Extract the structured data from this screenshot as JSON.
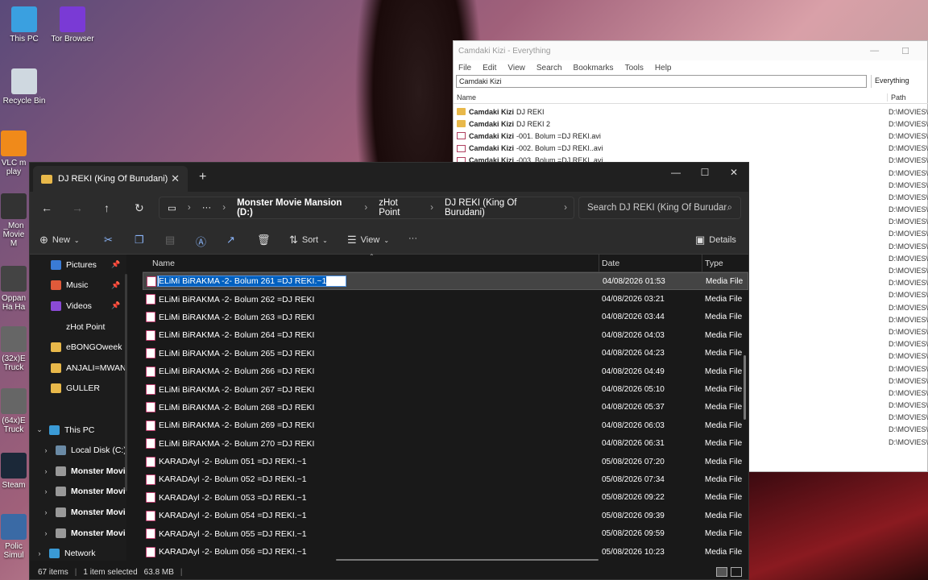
{
  "desktop": {
    "icons": [
      {
        "label": "This PC"
      },
      {
        "label": "Tor Browser"
      },
      {
        "label": "Recycle Bin"
      },
      {
        "label": "VLC m\nplay"
      },
      {
        "label": "_Mon\nMovie M"
      },
      {
        "label": "Oppan\nHa Ha"
      },
      {
        "label": "(32x)E\nTruck"
      },
      {
        "label": "(64x)E\nTruck"
      },
      {
        "label": "Steam"
      },
      {
        "label": "Polic\nSimul"
      }
    ]
  },
  "everything": {
    "title": "Camdaki Kizi - Everything",
    "menu": [
      "File",
      "Edit",
      "View",
      "Search",
      "Bookmarks",
      "Tools",
      "Help"
    ],
    "search_value": "Camdaki Kizi",
    "filter": "Everything",
    "col_name": "Name",
    "col_path": "Path",
    "rows": [
      {
        "type": "folder",
        "bold": "Camdaki Kizi",
        "rest": "DJ REKI"
      },
      {
        "type": "folder",
        "bold": "Camdaki Kizi",
        "rest": "DJ REKI 2"
      },
      {
        "type": "media",
        "bold": "Camdaki Kizi",
        "rest": "-001. Bolum =DJ REKI.avi"
      },
      {
        "type": "media",
        "bold": "Camdaki Kizi",
        "rest": "-002. Bolum =DJ REKI..avi"
      },
      {
        "type": "media",
        "bold": "Camdaki Kizi",
        "rest": "-003. Bolum =DJ REKI..avi"
      }
    ],
    "path_prefix": "D:\\MOVIES\\",
    "path_count": 28
  },
  "explorer": {
    "tab_title": "DJ REKI (King Of Burudani)",
    "breadcrumb": [
      "Monster Movie Mansion (D:)",
      "zHot Point",
      "DJ REKI (King Of Burudani)"
    ],
    "search_placeholder": "Search DJ REKI (King Of Burudar",
    "toolbar": {
      "new": "New",
      "sort": "Sort",
      "view": "View",
      "details": "Details"
    },
    "sidebar": [
      {
        "label": "Pictures",
        "color": "#3a7bd5",
        "pin": true,
        "indent": 26
      },
      {
        "label": "Music",
        "color": "#e05a3a",
        "pin": true,
        "indent": 26
      },
      {
        "label": "Videos",
        "color": "#8a4ad5",
        "pin": true,
        "indent": 26
      },
      {
        "label": "zHot Point",
        "color": "",
        "pin": false,
        "indent": 26
      },
      {
        "label": "eBONGOweek",
        "color": "#e8b84a",
        "pin": false,
        "indent": 26
      },
      {
        "label": "ANJALI=MWAN",
        "color": "#e8b84a",
        "pin": false,
        "indent": 26
      },
      {
        "label": "GULLER",
        "color": "#e8b84a",
        "pin": false,
        "indent": 26
      },
      {
        "label": "",
        "color": "",
        "pin": false,
        "indent": 0
      },
      {
        "label": "This PC",
        "color": "#3a9ad5",
        "pin": false,
        "indent": 6,
        "chev": "⌄"
      },
      {
        "label": "Local Disk (C:)",
        "color": "#6a8aa5",
        "pin": false,
        "indent": 14,
        "chev": "›"
      },
      {
        "label": "Monster Movi",
        "color": "#999",
        "pin": false,
        "indent": 14,
        "chev": "›",
        "bold": true
      },
      {
        "label": "Monster Movi",
        "color": "#999",
        "pin": false,
        "indent": 14,
        "chev": "›",
        "bold": true
      },
      {
        "label": "Monster Movi",
        "color": "#999",
        "pin": false,
        "indent": 14,
        "chev": "›",
        "bold": true
      },
      {
        "label": "Monster Movi",
        "color": "#999",
        "pin": false,
        "indent": 14,
        "chev": "›",
        "bold": true
      },
      {
        "label": "Network",
        "color": "#3a9ad5",
        "pin": false,
        "indent": 6,
        "chev": "›"
      }
    ],
    "columns": {
      "name": "Name",
      "date": "Date",
      "type": "Type"
    },
    "files": [
      {
        "name": "ELiMi BiRAKMA -2- Bolum 261 =DJ REKI.~1",
        "date": "04/08/2026 01:53",
        "type": "Media File",
        "selected": true
      },
      {
        "name": "ELiMi BiRAKMA -2- Bolum 262 =DJ REKI",
        "date": "04/08/2026 03:21",
        "type": "Media File"
      },
      {
        "name": "ELiMi BiRAKMA -2- Bolum 263 =DJ REKI",
        "date": "04/08/2026 03:44",
        "type": "Media File"
      },
      {
        "name": "ELiMi BiRAKMA -2- Bolum 264 =DJ REKI",
        "date": "04/08/2026 04:03",
        "type": "Media File"
      },
      {
        "name": "ELiMi BiRAKMA -2- Bolum 265 =DJ REKI",
        "date": "04/08/2026 04:23",
        "type": "Media File"
      },
      {
        "name": "ELiMi BiRAKMA -2- Bolum 266 =DJ REKI",
        "date": "04/08/2026 04:49",
        "type": "Media File"
      },
      {
        "name": "ELiMi BiRAKMA -2- Bolum 267 =DJ REKI",
        "date": "04/08/2026 05:10",
        "type": "Media File"
      },
      {
        "name": "ELiMi BiRAKMA -2- Bolum 268 =DJ REKI",
        "date": "04/08/2026 05:37",
        "type": "Media File"
      },
      {
        "name": "ELiMi BiRAKMA -2- Bolum 269 =DJ REKI",
        "date": "04/08/2026 06:03",
        "type": "Media File"
      },
      {
        "name": "ELiMi BiRAKMA -2- Bolum 270 =DJ REKI",
        "date": "04/08/2026 06:31",
        "type": "Media File"
      },
      {
        "name": "KARADAyl -2- Bolum 051 =DJ REKI.~1",
        "date": "05/08/2026 07:20",
        "type": "Media File"
      },
      {
        "name": "KARADAyl -2- Bolum 052 =DJ REKI.~1",
        "date": "05/08/2026 07:34",
        "type": "Media File"
      },
      {
        "name": "KARADAyl -2- Bolum 053 =DJ REKI.~1",
        "date": "05/08/2026 09:22",
        "type": "Media File"
      },
      {
        "name": "KARADAyl -2- Bolum 054 =DJ REKI.~1",
        "date": "05/08/2026 09:39",
        "type": "Media File"
      },
      {
        "name": "KARADAyl -2- Bolum 055 =DJ REKI.~1",
        "date": "05/08/2026 09:59",
        "type": "Media File"
      },
      {
        "name": "KARADAyl -2- Bolum 056 =DJ REKI.~1",
        "date": "05/08/2026 10:23",
        "type": "Media File"
      }
    ],
    "status": {
      "items": "67 items",
      "selected": "1 item selected",
      "size": "63.8 MB"
    }
  }
}
